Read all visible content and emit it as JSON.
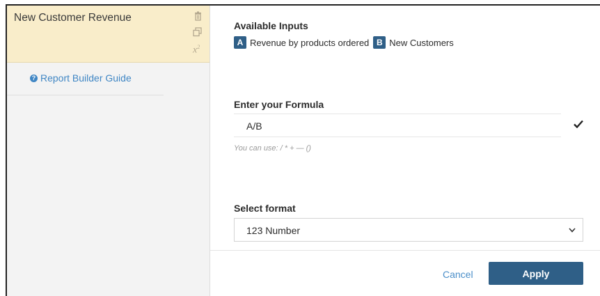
{
  "metric": {
    "title": "New Customer Revenue",
    "icons": [
      "trash-icon",
      "duplicate-icon",
      "superscript-icon"
    ]
  },
  "sidebar": {
    "guide_link": "Report Builder Guide",
    "guide_icon": "help-circle-icon"
  },
  "inputs": {
    "label": "Available Inputs",
    "items": [
      {
        "letter": "A",
        "name": "Revenue by products ordered"
      },
      {
        "letter": "B",
        "name": "New Customers"
      }
    ]
  },
  "formula": {
    "label": "Enter your Formula",
    "value": "A/B",
    "hint": "You can use: / * + — ()",
    "status_icon": "checkmark-icon"
  },
  "format": {
    "label": "Select format",
    "selected": "123 Number"
  },
  "actions": {
    "cancel": "Cancel",
    "apply": "Apply"
  },
  "colors": {
    "accent": "#2f5f87",
    "link": "#3f86c4",
    "metric_card_bg": "#f9edca",
    "sidebar_bg": "#f3f3f3"
  }
}
